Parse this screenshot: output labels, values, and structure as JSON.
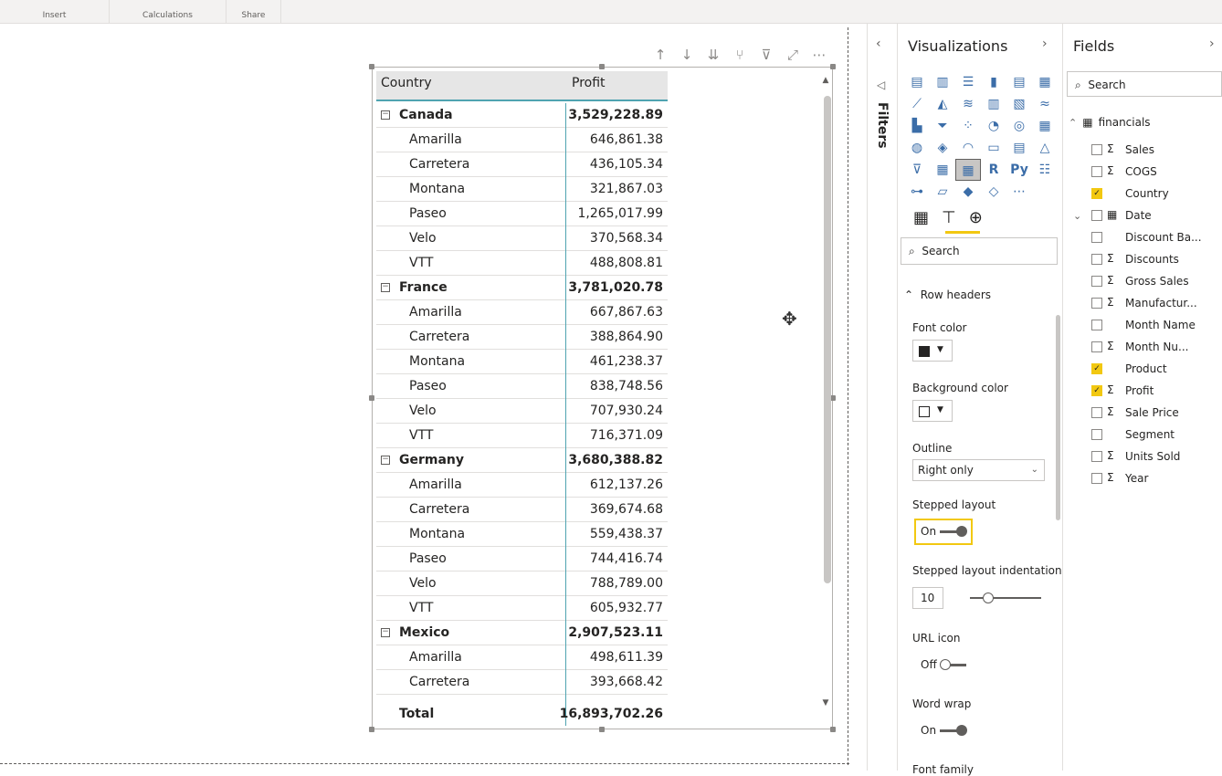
{
  "ribbon": {
    "groups": [
      "Insert",
      "Calculations",
      "Share"
    ]
  },
  "matrix": {
    "headers": {
      "country": "Country",
      "profit": "Profit"
    },
    "rows": [
      {
        "type": "parent",
        "label": "Canada",
        "value": "3,529,228.89"
      },
      {
        "type": "child",
        "label": "Amarilla",
        "value": "646,861.38"
      },
      {
        "type": "child",
        "label": "Carretera",
        "value": "436,105.34"
      },
      {
        "type": "child",
        "label": "Montana",
        "value": "321,867.03"
      },
      {
        "type": "child",
        "label": "Paseo",
        "value": "1,265,017.99"
      },
      {
        "type": "child",
        "label": "Velo",
        "value": "370,568.34"
      },
      {
        "type": "child",
        "label": "VTT",
        "value": "488,808.81"
      },
      {
        "type": "parent",
        "label": "France",
        "value": "3,781,020.78"
      },
      {
        "type": "child",
        "label": "Amarilla",
        "value": "667,867.63"
      },
      {
        "type": "child",
        "label": "Carretera",
        "value": "388,864.90"
      },
      {
        "type": "child",
        "label": "Montana",
        "value": "461,238.37"
      },
      {
        "type": "child",
        "label": "Paseo",
        "value": "838,748.56"
      },
      {
        "type": "child",
        "label": "Velo",
        "value": "707,930.24"
      },
      {
        "type": "child",
        "label": "VTT",
        "value": "716,371.09"
      },
      {
        "type": "parent",
        "label": "Germany",
        "value": "3,680,388.82"
      },
      {
        "type": "child",
        "label": "Amarilla",
        "value": "612,137.26"
      },
      {
        "type": "child",
        "label": "Carretera",
        "value": "369,674.68"
      },
      {
        "type": "child",
        "label": "Montana",
        "value": "559,438.37"
      },
      {
        "type": "child",
        "label": "Paseo",
        "value": "744,416.74"
      },
      {
        "type": "child",
        "label": "Velo",
        "value": "788,789.00"
      },
      {
        "type": "child",
        "label": "VTT",
        "value": "605,932.77"
      },
      {
        "type": "parent",
        "label": "Mexico",
        "value": "2,907,523.11"
      },
      {
        "type": "child",
        "label": "Amarilla",
        "value": "498,611.39"
      },
      {
        "type": "child",
        "label": "Carretera",
        "value": "393,668.42"
      }
    ],
    "total": {
      "label": "Total",
      "value": "16,893,702.26"
    }
  },
  "filters": {
    "label": "Filters"
  },
  "visualizations": {
    "title": "Visualizations",
    "search_placeholder": "Search",
    "section": "Row headers",
    "font_color_label": "Font color",
    "font_color": "#252423",
    "background_color_label": "Background color",
    "background_color": "#ffffff",
    "outline_label": "Outline",
    "outline_value": "Right only",
    "stepped_layout_label": "Stepped layout",
    "stepped_layout_value": "On",
    "indentation_label": "Stepped layout indentation",
    "indentation_value": "10",
    "url_icon_label": "URL icon",
    "url_icon_value": "Off",
    "word_wrap_label": "Word wrap",
    "word_wrap_value": "On",
    "font_family_label": "Font family"
  },
  "fields": {
    "title": "Fields",
    "search_placeholder": "Search",
    "table": "financials",
    "items": [
      {
        "name": "Sales",
        "checked": false,
        "sigma": true
      },
      {
        "name": "COGS",
        "checked": false,
        "sigma": true
      },
      {
        "name": "Country",
        "checked": true,
        "sigma": false
      },
      {
        "name": "Date",
        "checked": false,
        "sigma": false
      },
      {
        "name": "Discount Ba...",
        "checked": false,
        "sigma": false
      },
      {
        "name": "Discounts",
        "checked": false,
        "sigma": true
      },
      {
        "name": "Gross Sales",
        "checked": false,
        "sigma": true
      },
      {
        "name": "Manufactur...",
        "checked": false,
        "sigma": true
      },
      {
        "name": "Month Name",
        "checked": false,
        "sigma": false
      },
      {
        "name": "Month Nu...",
        "checked": false,
        "sigma": true
      },
      {
        "name": "Product",
        "checked": true,
        "sigma": false
      },
      {
        "name": "Profit",
        "checked": true,
        "sigma": true
      },
      {
        "name": "Sale Price",
        "checked": false,
        "sigma": true
      },
      {
        "name": "Segment",
        "checked": false,
        "sigma": false
      },
      {
        "name": "Units Sold",
        "checked": false,
        "sigma": true
      },
      {
        "name": "Year",
        "checked": false,
        "sigma": true
      }
    ]
  },
  "colors": {
    "accent": "#f2c811",
    "column_divider": "#4fa3b1"
  }
}
